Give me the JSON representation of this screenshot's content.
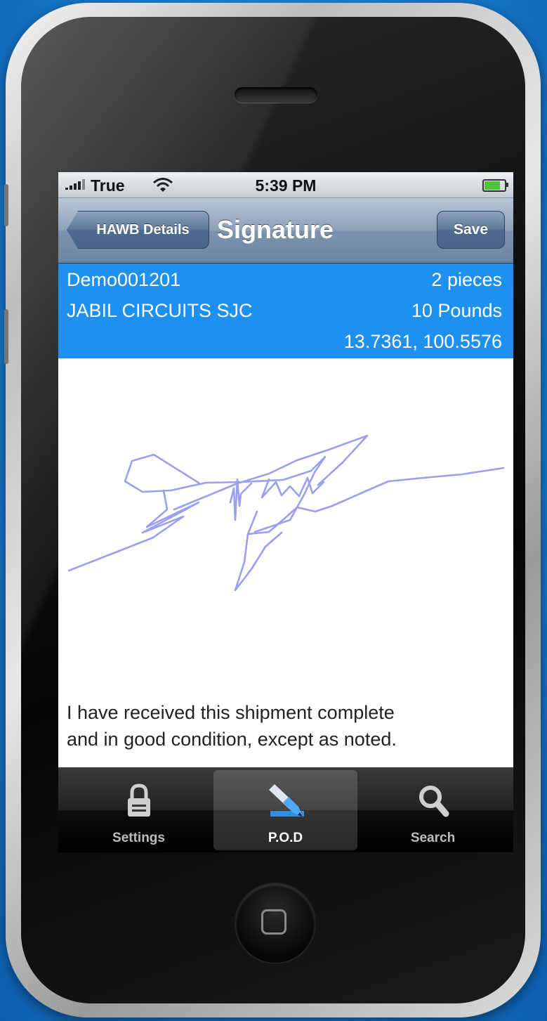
{
  "status_bar": {
    "carrier": "True",
    "time": "5:39 PM",
    "icons": [
      "signal-bars-icon",
      "wifi-icon",
      "battery-icon"
    ]
  },
  "navbar": {
    "back_label": "HAWB Details",
    "title": "Signature",
    "save_label": "Save"
  },
  "shipment": {
    "id": "Demo001201",
    "pieces": "2 pieces",
    "shipper": "JABIL CIRCUITS SJC",
    "weight": "10 Pounds",
    "coordinates": "13.7361, 100.5576"
  },
  "signature": {
    "ink_color": "#9a9ff0"
  },
  "disclaimer": {
    "line1": "I have received this shipment complete",
    "line2": "and in good condition, except as noted."
  },
  "tabs": [
    {
      "label": "Settings",
      "icon": "lock-icon",
      "active": false
    },
    {
      "label": "P.O.D",
      "icon": "pen-icon",
      "active": true
    },
    {
      "label": "Search",
      "icon": "search-icon",
      "active": false
    }
  ],
  "colors": {
    "info_bar": "#1e90f0",
    "nav_bar": "#7d93ad",
    "background": "#1a7fd1"
  }
}
